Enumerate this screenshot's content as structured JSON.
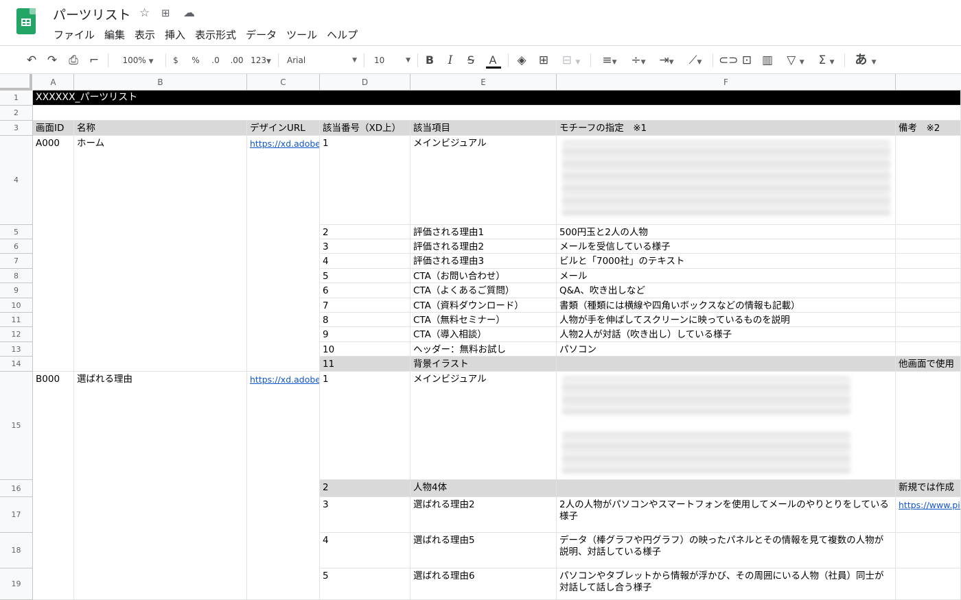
{
  "app": {
    "title": "パーツリスト",
    "menus": [
      "ファイル",
      "編集",
      "表示",
      "挿入",
      "表示形式",
      "データ",
      "ツール",
      "ヘルプ"
    ]
  },
  "toolbar": {
    "zoom": "100%",
    "currency": "$",
    "percent": "%",
    "decrease_decimal": ".0",
    "increase_decimal": ".00",
    "number_format": "123",
    "font": "Arial",
    "font_size": "10",
    "bold": "B",
    "italic": "I",
    "strike": "S",
    "text_color": "A",
    "input_tool": "あ"
  },
  "grid": {
    "columns": [
      "A",
      "B",
      "C",
      "D",
      "E",
      "F"
    ],
    "rows": [
      "1",
      "2",
      "3",
      "4",
      "5",
      "6",
      "7",
      "8",
      "9",
      "10",
      "11",
      "12",
      "13",
      "14",
      "15",
      "16",
      "17",
      "18",
      "19"
    ],
    "sheet_title": "XXXXXX_パーツリスト",
    "headers": {
      "a": "画面ID",
      "b": "名称",
      "c": "デザインURL",
      "d": "該当番号（XD上）",
      "e": "該当項目",
      "f": "モチーフの指定　※1",
      "g": "備考　※2"
    },
    "screens": [
      {
        "id": "A000",
        "name": "ホーム",
        "url": "https://xd.adobe.c"
      },
      {
        "id": "B000",
        "name": "選ばれる理由",
        "url": "https://xd.adobe.c"
      }
    ],
    "items": [
      {
        "num": "1",
        "item": "メインビジュアル",
        "motif": "",
        "note": ""
      },
      {
        "num": "2",
        "item": "評価される理由1",
        "motif": "500円玉と2人の人物",
        "note": ""
      },
      {
        "num": "3",
        "item": "評価される理由2",
        "motif": "メールを受信している様子",
        "note": ""
      },
      {
        "num": "4",
        "item": "評価される理由3",
        "motif": "ビルと「7000社」のテキスト",
        "note": ""
      },
      {
        "num": "5",
        "item": "CTA（お問い合わせ）",
        "motif": "メール",
        "note": ""
      },
      {
        "num": "6",
        "item": "CTA（よくあるご質問）",
        "motif": "Q&A、吹き出しなど",
        "note": ""
      },
      {
        "num": "7",
        "item": "CTA（資料ダウンロード）",
        "motif": "書類（種類には横線や四角いボックスなどの情報も記載）",
        "note": ""
      },
      {
        "num": "8",
        "item": "CTA（無料セミナー）",
        "motif": "人物が手を伸ばしてスクリーンに映っているものを説明",
        "note": ""
      },
      {
        "num": "9",
        "item": "CTA（導入相談）",
        "motif": "人物2人が対話（吹き出し）している様子",
        "note": ""
      },
      {
        "num": "10",
        "item": "ヘッダー：無料お試し",
        "motif": "パソコン",
        "note": ""
      },
      {
        "num": "11",
        "item": "背景イラスト",
        "motif": "",
        "note": "他画面で使用"
      },
      {
        "num": "1",
        "item": "メインビジュアル",
        "motif": "",
        "note": ""
      },
      {
        "num": "2",
        "item": "人物4体",
        "motif": "",
        "note": "新規では作成"
      },
      {
        "num": "3",
        "item": "選ばれる理由2",
        "motif": "2人の人物がパソコンやスマートフォンを使用してメールのやりとりをしている様子",
        "note": "https://www.pint"
      },
      {
        "num": "4",
        "item": "選ばれる理由5",
        "motif": "データ（棒グラフや円グラフ）の映ったパネルとその情報を見て複数の人物が説明、対話している様子",
        "note": ""
      },
      {
        "num": "5",
        "item": "選ばれる理由6",
        "motif": "パソコンやタブレットから情報が浮かび、その周囲にいる人物（社員）同士が対話して話し合う様子",
        "note": ""
      }
    ]
  }
}
